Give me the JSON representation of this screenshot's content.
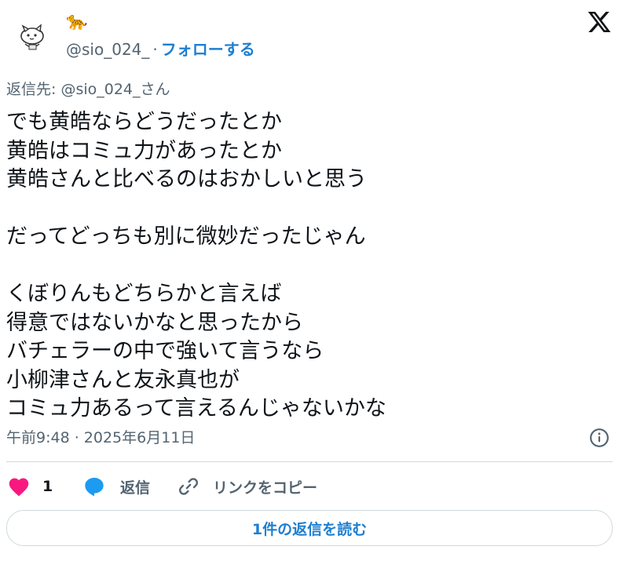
{
  "header": {
    "display_name": "🐆",
    "handle": "@sio_024_",
    "separator": "·",
    "follow_label": "フォローする"
  },
  "tweet": {
    "reply_to": "返信先: @sio_024_さん",
    "lines": [
      "でも黄皓ならどうだったとか",
      "黄皓はコミュ力があったとか",
      "黄皓さんと比べるのはおかしいと思う",
      "",
      "だってどっちも別に微妙だったじゃん",
      "",
      "くぼりんもどちらかと言えば",
      "得意ではないかなと思ったから",
      "バチェラーの中で強いて言うなら",
      "小柳津さんと友永真也が",
      "コミュ力あるって言えるんじゃないかな"
    ],
    "timestamp": "午前9:48 · 2025年6月11日"
  },
  "actions": {
    "like_count": "1",
    "reply_label": "返信",
    "copy_link_label": "リンクをコピー"
  },
  "read_replies_label": "1件の返信を読む",
  "colors": {
    "like": "#f91880",
    "reply": "#1d9bf0",
    "link": "#1d7fd1",
    "muted": "#536471"
  }
}
